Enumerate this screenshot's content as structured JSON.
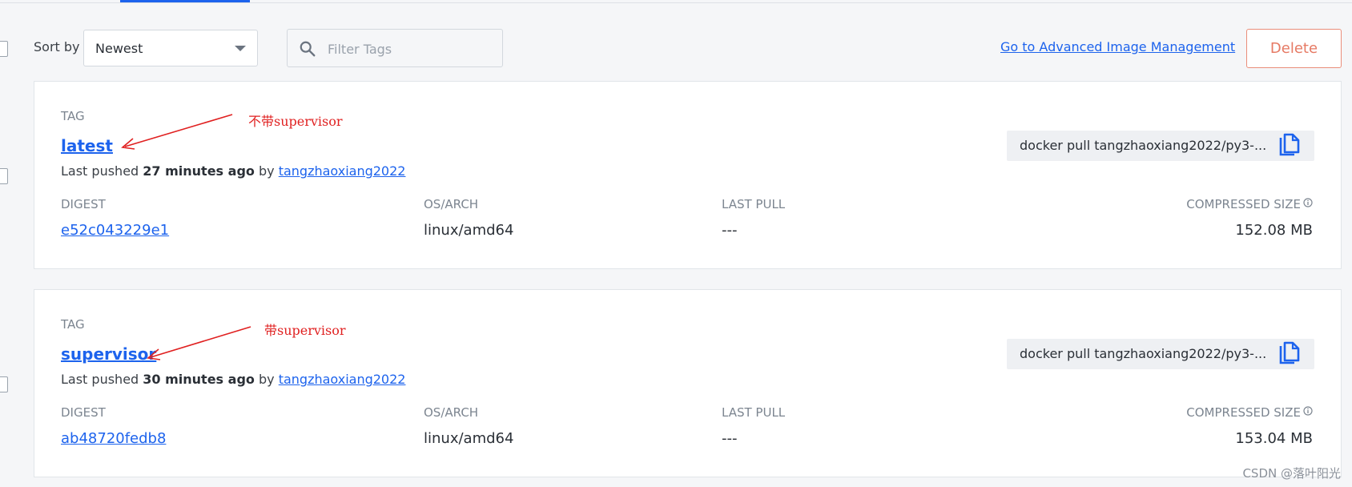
{
  "toolbar": {
    "sort_label": "Sort by",
    "sort_value": "Newest",
    "filter_placeholder": "Filter Tags",
    "advanced_link": "Go to Advanced Image Management",
    "delete_label": "Delete"
  },
  "tags": [
    {
      "tag_label": "TAG",
      "name": "latest",
      "pushed_prefix": "Last pushed",
      "pushed_time": "27 minutes ago",
      "pushed_by_word": "by",
      "pushed_by": "tangzhaoxiang2022",
      "pull_command": "docker pull tangzhaoxiang2022/py3-...",
      "digest_label": "DIGEST",
      "digest": "e52c043229e1",
      "os_label": "OS/ARCH",
      "os": "linux/amd64",
      "last_pull_label": "LAST PULL",
      "last_pull": "---",
      "size_label": "COMPRESSED SIZE",
      "size": "152.08 MB",
      "annotation": "不带supervisor"
    },
    {
      "tag_label": "TAG",
      "name": "supervisor",
      "pushed_prefix": "Last pushed",
      "pushed_time": "30 minutes ago",
      "pushed_by_word": "by",
      "pushed_by": "tangzhaoxiang2022",
      "pull_command": "docker pull tangzhaoxiang2022/py3-...",
      "digest_label": "DIGEST",
      "digest": "ab48720fedb8",
      "os_label": "OS/ARCH",
      "os": "linux/amd64",
      "last_pull_label": "LAST PULL",
      "last_pull": "---",
      "size_label": "COMPRESSED SIZE",
      "size": "153.04 MB",
      "annotation": "带supervisor"
    }
  ],
  "watermark": "CSDN @落叶阳光",
  "colors": {
    "link": "#1d63ed",
    "delete": "#e67a64",
    "annotation": "#e02020"
  },
  "icons": [
    "search-icon",
    "chevron-down-icon",
    "copy-icon",
    "info-icon",
    "arrow-annotation"
  ]
}
